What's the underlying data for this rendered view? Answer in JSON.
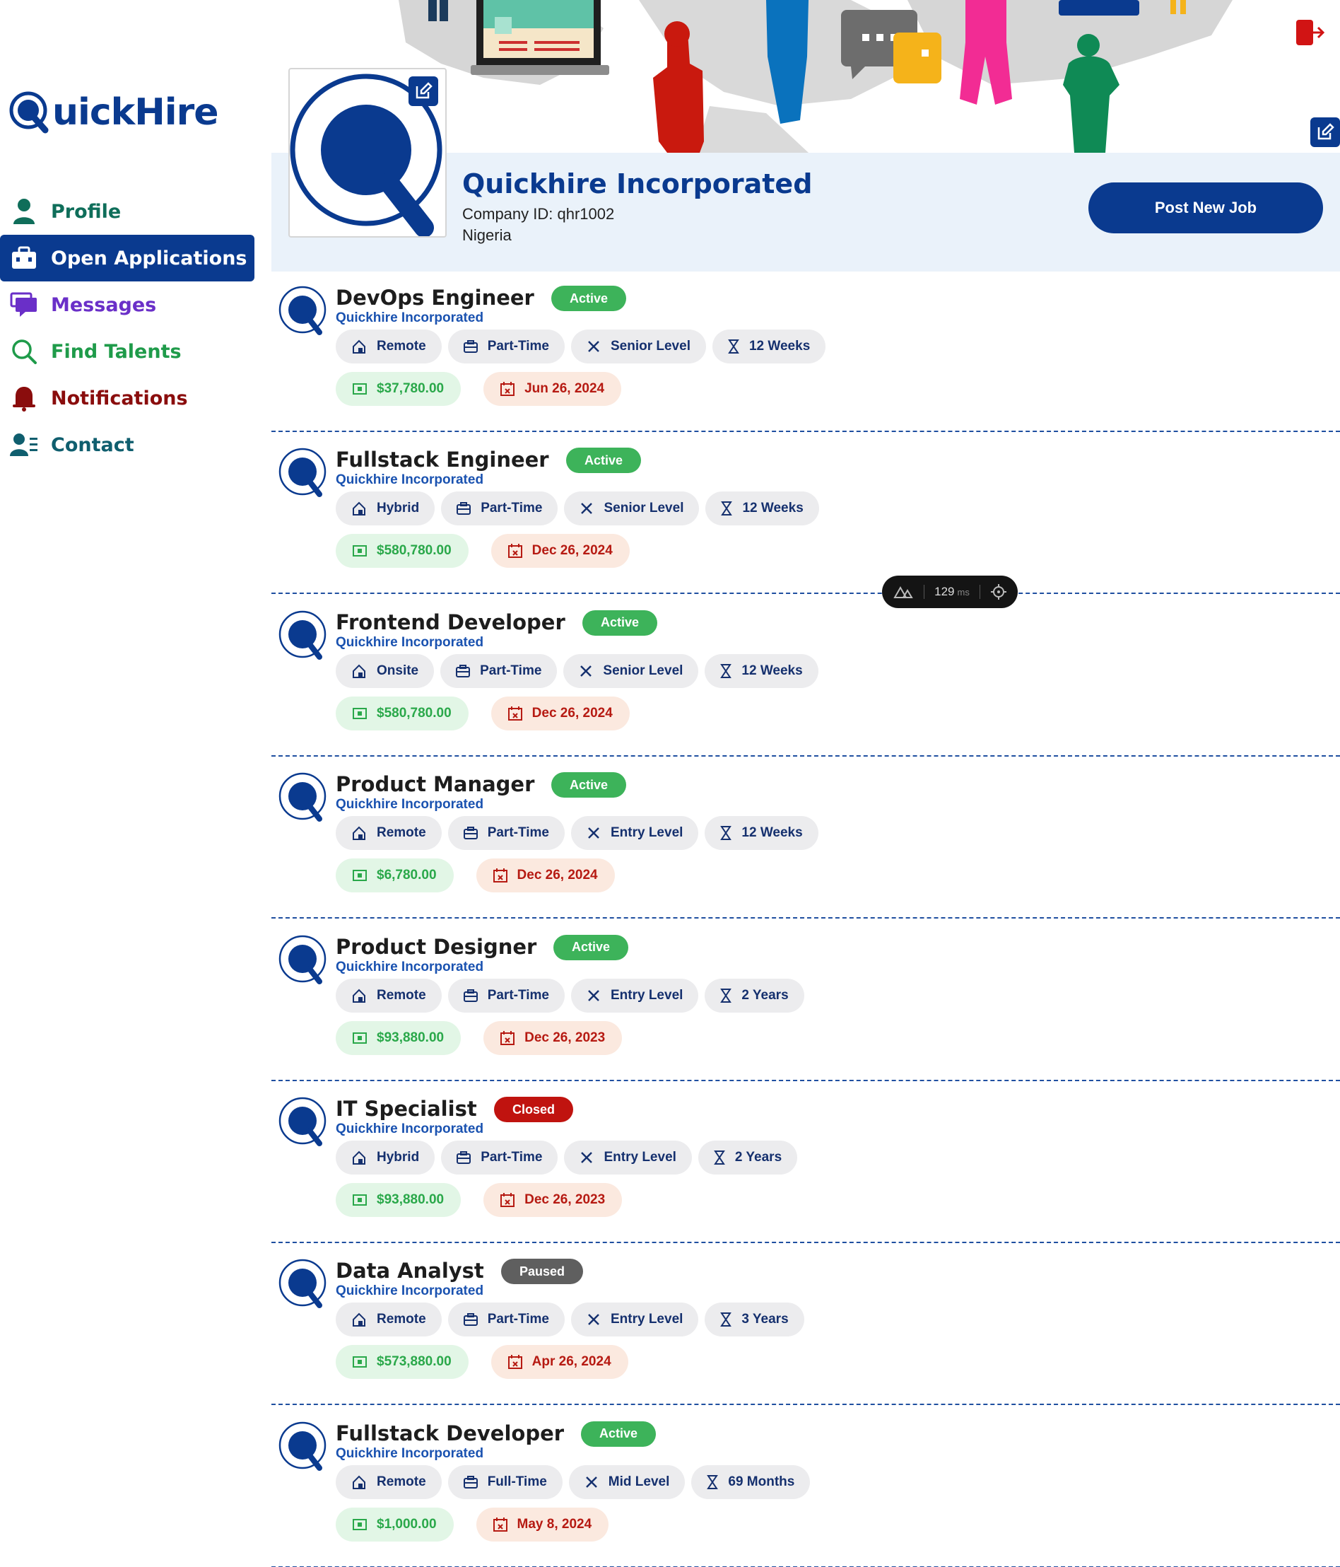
{
  "app": {
    "logo_text": "uickHire",
    "logo_letter": "Q"
  },
  "sidebar": {
    "items": [
      {
        "label": "Profile",
        "icon": "user-icon",
        "color": "#0f6e5a"
      },
      {
        "label": "Open Applications",
        "icon": "briefcase-icon",
        "color": "#ffffff",
        "active": true
      },
      {
        "label": "Messages",
        "icon": "chat-icon",
        "color": "#6a2fc8"
      },
      {
        "label": "Find Talents",
        "icon": "search-icon",
        "color": "#1f9b4a"
      },
      {
        "label": "Notifications",
        "icon": "bell-icon",
        "color": "#8a0d0d"
      },
      {
        "label": "Contact",
        "icon": "contact-icon",
        "color": "#0f5e6e"
      }
    ]
  },
  "company": {
    "name": "Quickhire Incorporated",
    "id_line": "Company ID: qhr1002",
    "country": "Nigeria",
    "post_job_label": "Post New Job"
  },
  "perf_badge": {
    "value": "129",
    "unit": "ms"
  },
  "colors": {
    "brand": "#0a3a8f",
    "active": "#3db35a",
    "closed": "#c0130f",
    "paused": "#5f5f5f",
    "salary": "#2aa84a",
    "deadline": "#b61a12"
  },
  "jobs": [
    {
      "title": "DevOps Engineer",
      "company": "Quickhire Incorporated",
      "status": "Active",
      "location": "Remote",
      "type": "Part-Time",
      "level": "Senior Level",
      "duration": "12 Weeks",
      "salary": "$37,780.00",
      "deadline": "Jun 26, 2024"
    },
    {
      "title": "Fullstack Engineer",
      "company": "Quickhire Incorporated",
      "status": "Active",
      "location": "Hybrid",
      "type": "Part-Time",
      "level": "Senior Level",
      "duration": "12 Weeks",
      "salary": "$580,780.00",
      "deadline": "Dec 26, 2024"
    },
    {
      "title": "Frontend Developer",
      "company": "Quickhire Incorporated",
      "status": "Active",
      "location": "Onsite",
      "type": "Part-Time",
      "level": "Senior Level",
      "duration": "12 Weeks",
      "salary": "$580,780.00",
      "deadline": "Dec 26, 2024"
    },
    {
      "title": "Product Manager",
      "company": "Quickhire Incorporated",
      "status": "Active",
      "location": "Remote",
      "type": "Part-Time",
      "level": "Entry Level",
      "duration": "12 Weeks",
      "salary": "$6,780.00",
      "deadline": "Dec 26, 2024"
    },
    {
      "title": "Product Designer",
      "company": "Quickhire Incorporated",
      "status": "Active",
      "location": "Remote",
      "type": "Part-Time",
      "level": "Entry Level",
      "duration": "2 Years",
      "salary": "$93,880.00",
      "deadline": "Dec 26, 2023"
    },
    {
      "title": "IT Specialist",
      "company": "Quickhire Incorporated",
      "status": "Closed",
      "location": "Hybrid",
      "type": "Part-Time",
      "level": "Entry Level",
      "duration": "2 Years",
      "salary": "$93,880.00",
      "deadline": "Dec 26, 2023"
    },
    {
      "title": "Data Analyst",
      "company": "Quickhire Incorporated",
      "status": "Paused",
      "location": "Remote",
      "type": "Part-Time",
      "level": "Entry Level",
      "duration": "3 Years",
      "salary": "$573,880.00",
      "deadline": "Apr 26, 2024"
    },
    {
      "title": "Fullstack Developer",
      "company": "Quickhire Incorporated",
      "status": "Active",
      "location": "Remote",
      "type": "Full-Time",
      "level": "Mid Level",
      "duration": "69 Months",
      "salary": "$1,000.00",
      "deadline": "May 8, 2024"
    }
  ]
}
